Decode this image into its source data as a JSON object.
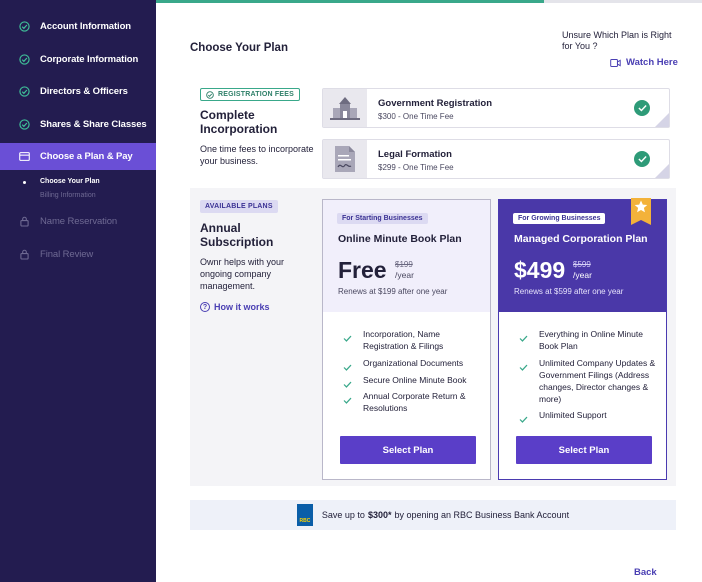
{
  "sidebar": {
    "items": [
      {
        "label": "Account Information",
        "state": "done"
      },
      {
        "label": "Corporate Information",
        "state": "done"
      },
      {
        "label": "Directors & Officers",
        "state": "done"
      },
      {
        "label": "Shares & Share Classes",
        "state": "done"
      },
      {
        "label": "Choose a Plan & Pay",
        "state": "active"
      },
      {
        "label": "Name Reservation",
        "state": "locked"
      },
      {
        "label": "Final Review",
        "state": "locked"
      }
    ],
    "sub_items": [
      "Choose Your Plan",
      "Billing Information"
    ]
  },
  "progress": {
    "fraction": 0.71
  },
  "header": {
    "title": "Choose Your Plan",
    "unsure_text": "Unsure Which Plan is Right for You ?",
    "watch_label": "Watch Here"
  },
  "registration": {
    "badge": "REGISTRATION FEES",
    "title": "Complete Incorporation",
    "description": "One time fees to incorporate your business.",
    "fees": [
      {
        "name": "Government Registration",
        "price": "$300 - One Time Fee"
      },
      {
        "name": "Legal Formation",
        "price": "$299 - One Time Fee"
      }
    ]
  },
  "plans": {
    "badge": "AVAILABLE PLANS",
    "title": "Annual Subscription",
    "description": "Ownr helps with your ongoing company management.",
    "how_label": "How it works",
    "free": {
      "tag": "For Starting Businesses",
      "name": "Online Minute Book Plan",
      "amount": "Free",
      "original": "$199",
      "per": "/year",
      "renews": "Renews at $199 after one year",
      "features": [
        "Incorporation, Name Registration & Filings",
        "Organizational Documents",
        "Secure Online Minute Book",
        "Annual Corporate Return & Resolutions"
      ],
      "button": "Select Plan"
    },
    "managed": {
      "tag": "For Growing Businesses",
      "name": "Managed Corporation Plan",
      "amount": "$499",
      "original": "$599",
      "per": "/year",
      "renews": "Renews at $599 after one year",
      "features": [
        "Everything in Online Minute Book Plan",
        "Unlimited Company Updates & Government Filings (Address changes, Director changes & more)",
        "Unlimited Support"
      ],
      "button": "Select Plan"
    }
  },
  "rbc": {
    "logo_text": "RBC",
    "before": "Save up to",
    "amount": "$300*",
    "after": "by opening an RBC Business Bank Account"
  },
  "footer": {
    "back_label": "Back"
  },
  "colors": {
    "sidebar_bg": "#231c50",
    "active_nav": "#6a4fd6",
    "accent": "#5a3ec8",
    "success": "#39a88a"
  },
  "icons": {
    "done": "check-circle-icon",
    "active": "card-icon",
    "locked": "lock-icon",
    "watch": "video-icon",
    "help": "question-circle-icon"
  }
}
